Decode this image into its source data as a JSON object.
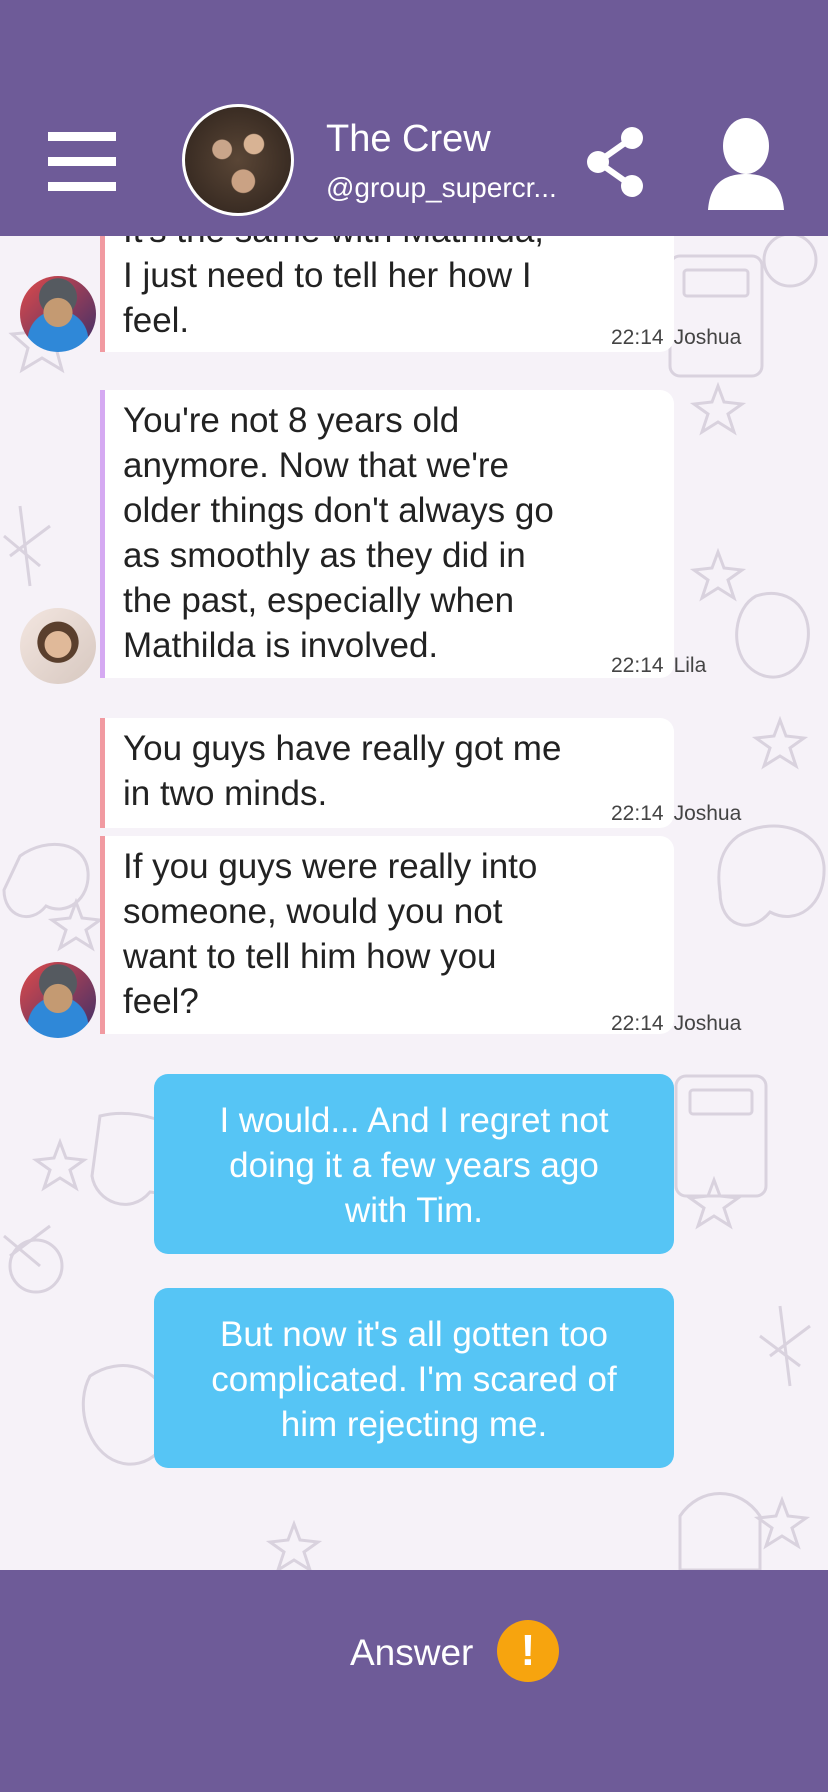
{
  "header": {
    "menu_icon": "hamburger-menu-icon",
    "title": "The Crew",
    "handle": "@group_supercr...",
    "share_icon": "share-icon",
    "profile_icon": "user-profile-icon"
  },
  "messages": [
    {
      "sender": "Joshua",
      "time": "22:14",
      "lines": [
        "It's the same with Mathilda,",
        "I just need to tell her how I",
        "feel."
      ]
    },
    {
      "sender": "Lila",
      "time": "22:14",
      "lines": [
        "You're not 8 years old",
        "anymore. Now that we're",
        "older things don't always go",
        "as smoothly as they did in",
        "the past, especially when",
        "Mathilda is involved."
      ]
    },
    {
      "sender": "Joshua",
      "time": "22:14",
      "lines": [
        "You guys have really got me",
        "in two minds."
      ]
    },
    {
      "sender": "Joshua",
      "time": "22:14",
      "lines": [
        "If you guys were really into",
        "someone, would you not",
        "want to tell him how you",
        "feel?"
      ]
    }
  ],
  "outgoing": [
    {
      "lines": [
        "I would... And I regret not",
        "doing it a few years ago",
        "with Tim."
      ]
    },
    {
      "lines": [
        "But now it's all gotten too",
        "complicated. I'm scared of",
        "him rejecting me."
      ]
    }
  ],
  "footer": {
    "answer_label": "Answer",
    "alert_icon": "exclamation-alert-icon",
    "alert_glyph": "!"
  },
  "colors": {
    "header_bg": "#6e5b98",
    "outgoing_bubble": "#56c5f5",
    "joshua_accent": "#f19aa1",
    "lila_accent": "#d5a9f2",
    "alert": "#f7a40e"
  }
}
